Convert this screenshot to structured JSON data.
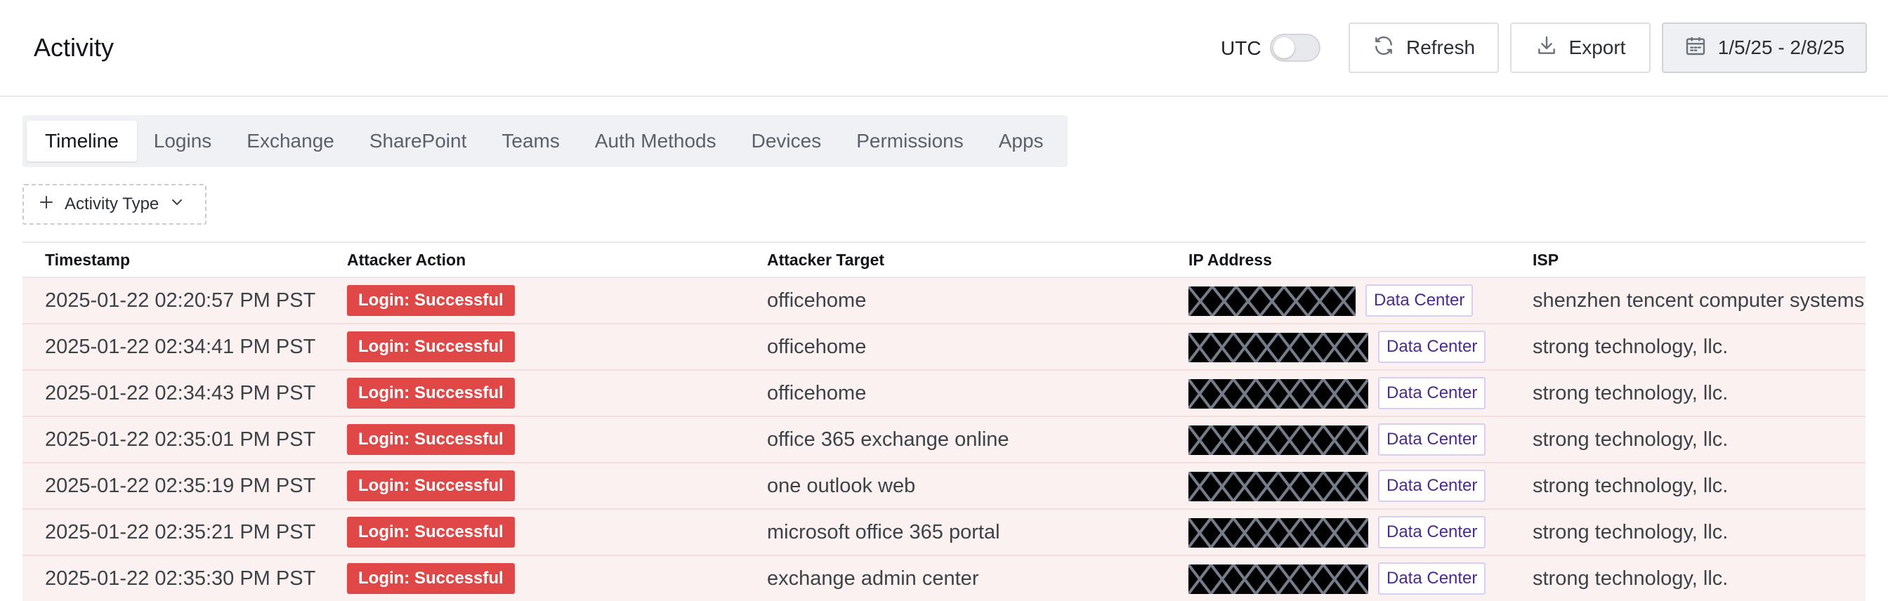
{
  "header": {
    "title": "Activity",
    "utc_label": "UTC",
    "utc_enabled": false,
    "refresh_label": "Refresh",
    "export_label": "Export",
    "date_range": "1/5/25 - 2/8/25"
  },
  "tabs": [
    {
      "label": "Timeline",
      "active": true
    },
    {
      "label": "Logins",
      "active": false
    },
    {
      "label": "Exchange",
      "active": false
    },
    {
      "label": "SharePoint",
      "active": false
    },
    {
      "label": "Teams",
      "active": false
    },
    {
      "label": "Auth Methods",
      "active": false
    },
    {
      "label": "Devices",
      "active": false
    },
    {
      "label": "Permissions",
      "active": false
    },
    {
      "label": "Apps",
      "active": false
    }
  ],
  "filter": {
    "label": "Activity Type"
  },
  "table": {
    "columns": [
      "Timestamp",
      "Attacker Action",
      "Attacker Target",
      "IP Address",
      "ISP"
    ],
    "rows": [
      {
        "timestamp": "2025-01-22 02:20:57 PM PST",
        "action": "Login: Successful",
        "target": "officehome",
        "ip_tag": "Data Center",
        "isp": "shenzhen tencent computer systems c"
      },
      {
        "timestamp": "2025-01-22 02:34:41 PM PST",
        "action": "Login: Successful",
        "target": "officehome",
        "ip_tag": "Data Center",
        "isp": "strong technology, llc."
      },
      {
        "timestamp": "2025-01-22 02:34:43 PM PST",
        "action": "Login: Successful",
        "target": "officehome",
        "ip_tag": "Data Center",
        "isp": "strong technology, llc."
      },
      {
        "timestamp": "2025-01-22 02:35:01 PM PST",
        "action": "Login: Successful",
        "target": "office 365 exchange online",
        "ip_tag": "Data Center",
        "isp": "strong technology, llc."
      },
      {
        "timestamp": "2025-01-22 02:35:19 PM PST",
        "action": "Login: Successful",
        "target": "one outlook web",
        "ip_tag": "Data Center",
        "isp": "strong technology, llc."
      },
      {
        "timestamp": "2025-01-22 02:35:21 PM PST",
        "action": "Login: Successful",
        "target": "microsoft office 365 portal",
        "ip_tag": "Data Center",
        "isp": "strong technology, llc."
      },
      {
        "timestamp": "2025-01-22 02:35:30 PM PST",
        "action": "Login: Successful",
        "target": "exchange admin center",
        "ip_tag": "Data Center",
        "isp": "strong technology, llc."
      }
    ]
  },
  "colors": {
    "row_background": "#fcf1f1",
    "action_badge": "#e04747",
    "data_center_text": "#4a2a8f",
    "data_center_border": "#d8cdf3",
    "redaction": "#000000"
  },
  "icons": {
    "refresh": "refresh-icon",
    "export": "download-icon",
    "date": "calendar-icon",
    "filter_add": "plus-icon",
    "filter_open": "chevron-down-icon"
  }
}
